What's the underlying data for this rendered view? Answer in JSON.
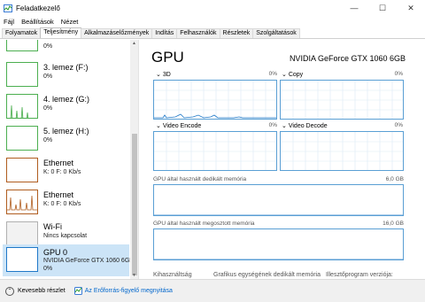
{
  "window": {
    "title": "Feladatkezelő"
  },
  "menu": [
    {
      "label": "Fájl"
    },
    {
      "label": "Beállítások"
    },
    {
      "label": "Nézet"
    }
  ],
  "tabs": [
    {
      "label": "Folyamatok"
    },
    {
      "label": "Teljesítmény"
    },
    {
      "label": "Alkalmazáselőzmények"
    },
    {
      "label": "Indítás"
    },
    {
      "label": "Felhasználók"
    },
    {
      "label": "Részletek"
    },
    {
      "label": "Szolgáltatások"
    }
  ],
  "active_tab": "Teljesítmény",
  "sidebar": {
    "items": [
      {
        "name": "",
        "sub": "0%",
        "color": "#4caf50"
      },
      {
        "name": "3. lemez (F:)",
        "sub": "0%",
        "color": "#4caf50"
      },
      {
        "name": "4. lemez (G:)",
        "sub": "0%",
        "color": "#4caf50"
      },
      {
        "name": "5. lemez (H:)",
        "sub": "0%",
        "color": "#4caf50"
      },
      {
        "name": "Ethernet",
        "sub": "K: 0 F: 0 Kb/s",
        "color": "#b05d1f"
      },
      {
        "name": "Ethernet",
        "sub": "K: 0 F: 0 Kb/s",
        "color": "#b05d1f"
      },
      {
        "name": "Wi-Fi",
        "sub": "Nincs kapcsolat",
        "color": "#b0b0b0"
      },
      {
        "name": "GPU 0",
        "sub": "NVIDIA GeForce GTX 1060 6GB",
        "sub2": "0%",
        "color": "#1f78c8"
      }
    ]
  },
  "main": {
    "title": "GPU",
    "model": "NVIDIA GeForce GTX 1060 6GB",
    "graphs": [
      {
        "label": "3D",
        "pct": "0%"
      },
      {
        "label": "Copy",
        "pct": "0%"
      },
      {
        "label": "Video Encode",
        "pct": "0%"
      },
      {
        "label": "Video Decode",
        "pct": "0%"
      }
    ],
    "dedicated": {
      "label": "GPU által használt dedikált memória",
      "value": "6,0 GB"
    },
    "shared": {
      "label": "GPU által használt megosztott memória",
      "value": "16,0 GB"
    },
    "footer_cols": [
      {
        "label": "Kihasználtság"
      },
      {
        "label": "Grafikus egységének dedikált memória"
      },
      {
        "label": "Illesztőprogram verziója:"
      }
    ]
  },
  "footer": {
    "fewer_details": "Kevesebb részlet",
    "resmon": "Az Erőforrás-figyelő megnyitása"
  },
  "colors": {
    "accent": "#1f78c8",
    "disk": "#4caf50",
    "net": "#b05d1f"
  }
}
